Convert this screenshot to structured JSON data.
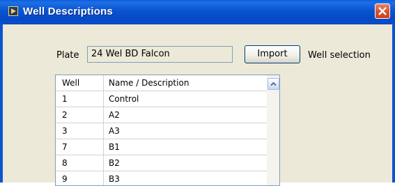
{
  "window": {
    "title": "Well Descriptions",
    "title_color": "#ffffff",
    "titlebar_color": "#0a54d0",
    "close_button_color": "#d9542f"
  },
  "plate": {
    "label": "Plate",
    "value": "24 Wel BD Falcon"
  },
  "import_button": {
    "label": "Import"
  },
  "well_selection": {
    "label": "Well selection"
  },
  "table": {
    "columns": [
      "Well",
      "Name / Description"
    ],
    "rows": [
      {
        "well": "1",
        "name": "Control"
      },
      {
        "well": "2",
        "name": "A2"
      },
      {
        "well": "3",
        "name": "A3"
      },
      {
        "well": "7",
        "name": "B1"
      },
      {
        "well": "8",
        "name": "B2"
      },
      {
        "well": "9",
        "name": "B3"
      }
    ]
  },
  "icons": {
    "app": "labview-app-icon",
    "close": "close-icon",
    "scroll_up": "chevron-up-icon"
  }
}
